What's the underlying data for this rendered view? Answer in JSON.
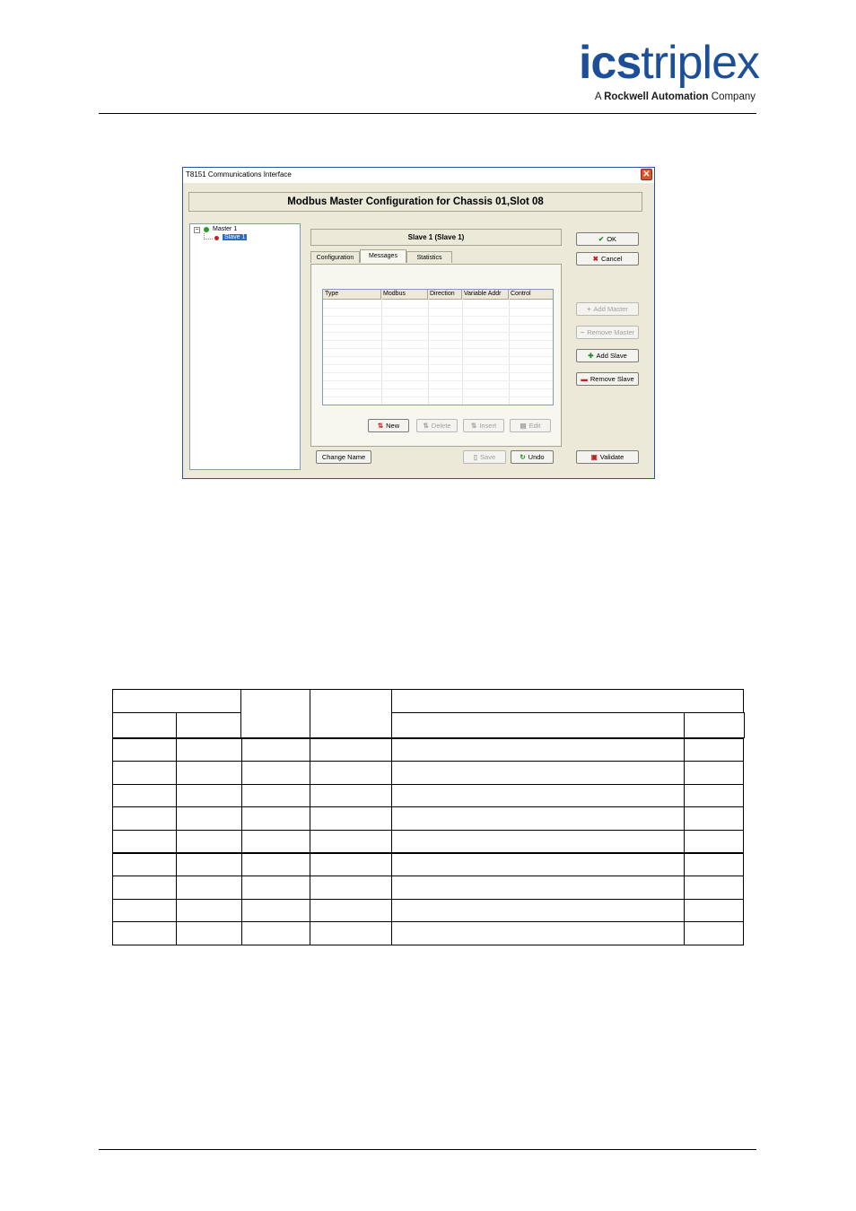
{
  "logo": {
    "brand_bold": "ics",
    "brand_light": "triplex",
    "tag_prefix": "A ",
    "tag_bold": "Rockwell Automation",
    "tag_suffix": " Company",
    "color": "#1c4f97"
  },
  "dialog": {
    "title": "T8151 Communications Interface",
    "close_label": "✕",
    "header": "Modbus Master Configuration for Chassis 01,Slot 08",
    "tree": {
      "expand_symbol": "−",
      "master": "Master 1",
      "slave": "Slave 1"
    },
    "slave_header": "Slave 1 (Slave 1)",
    "tabs": [
      "Configuration",
      "Messages",
      "Statistics"
    ],
    "active_tab": "Messages",
    "grid_columns": [
      "Type",
      "Modbus",
      "Direction",
      "Variable Addr",
      "Control"
    ],
    "grid_buttons": {
      "new": "New",
      "delete": "Delete",
      "insert": "Insert",
      "edit": "Edit"
    },
    "bottom_buttons": {
      "change_name": "Change Name",
      "save": "Save",
      "undo": "Undo"
    },
    "side_buttons": {
      "ok": "OK",
      "cancel": "Cancel",
      "add_master": "Add Master",
      "remove_master": "Remove Master",
      "add_slave": "Add Slave",
      "remove_slave": "Remove Slave",
      "validate": "Validate"
    },
    "icons": {
      "ok": "check-icon",
      "cancel": "x-icon",
      "add": "plus-icon",
      "remove": "minus-icon",
      "undo": "refresh-icon",
      "validate": "validate-icon"
    }
  }
}
